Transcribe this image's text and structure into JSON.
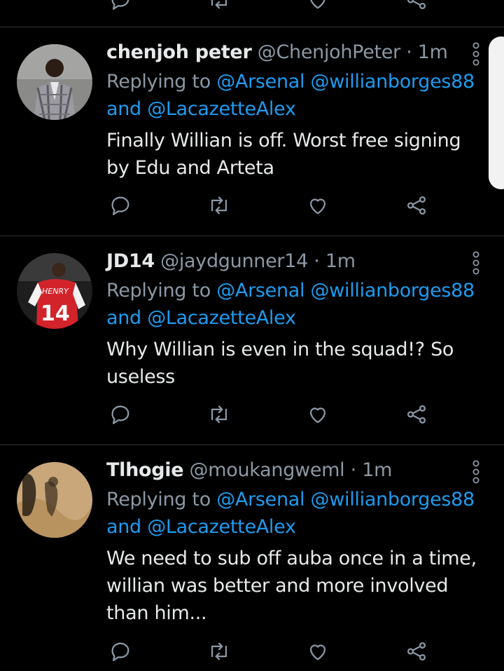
{
  "tweets": [
    {
      "name": "chenjoh peter",
      "handle": "@ChenjohPeter",
      "time": "· 1m",
      "replying_to": "Replying to",
      "mention1": "@Arsenal",
      "mention2": "@willianborges88",
      "and": "and",
      "mention3": "@LacazetteAlex",
      "text": "Finally Willian is off. Worst free signing by Edu and Arteta"
    },
    {
      "name": "JD14",
      "handle": "@jaydgunner14",
      "time": "· 1m",
      "replying_to": "Replying to",
      "mention1": "@Arsenal",
      "mention2": "@willianborges88",
      "and": "and",
      "mention3": "@LacazetteAlex",
      "text": "Why Willian is even in the squad!? So useless"
    },
    {
      "name": "Tlhogie",
      "handle": "@moukangweml",
      "time": "· 1m",
      "replying_to": "Replying to",
      "mention1": "@Arsenal",
      "mention2": "@willianborges88",
      "and": "and",
      "mention3": "@LacazetteAlex",
      "text": "We need to sub off auba once in a time, willian was better and more involved than him..."
    }
  ],
  "avatar_jersey": {
    "name": "HENRY",
    "number": "14"
  },
  "icons": [
    "reply-icon",
    "retweet-icon",
    "like-icon",
    "share-icon",
    "more-icon"
  ],
  "colors": {
    "background": "#000000",
    "text": "#e7e9ea",
    "muted": "#8b98a5",
    "accent": "#1d9bf0",
    "divider": "#2f3336"
  }
}
